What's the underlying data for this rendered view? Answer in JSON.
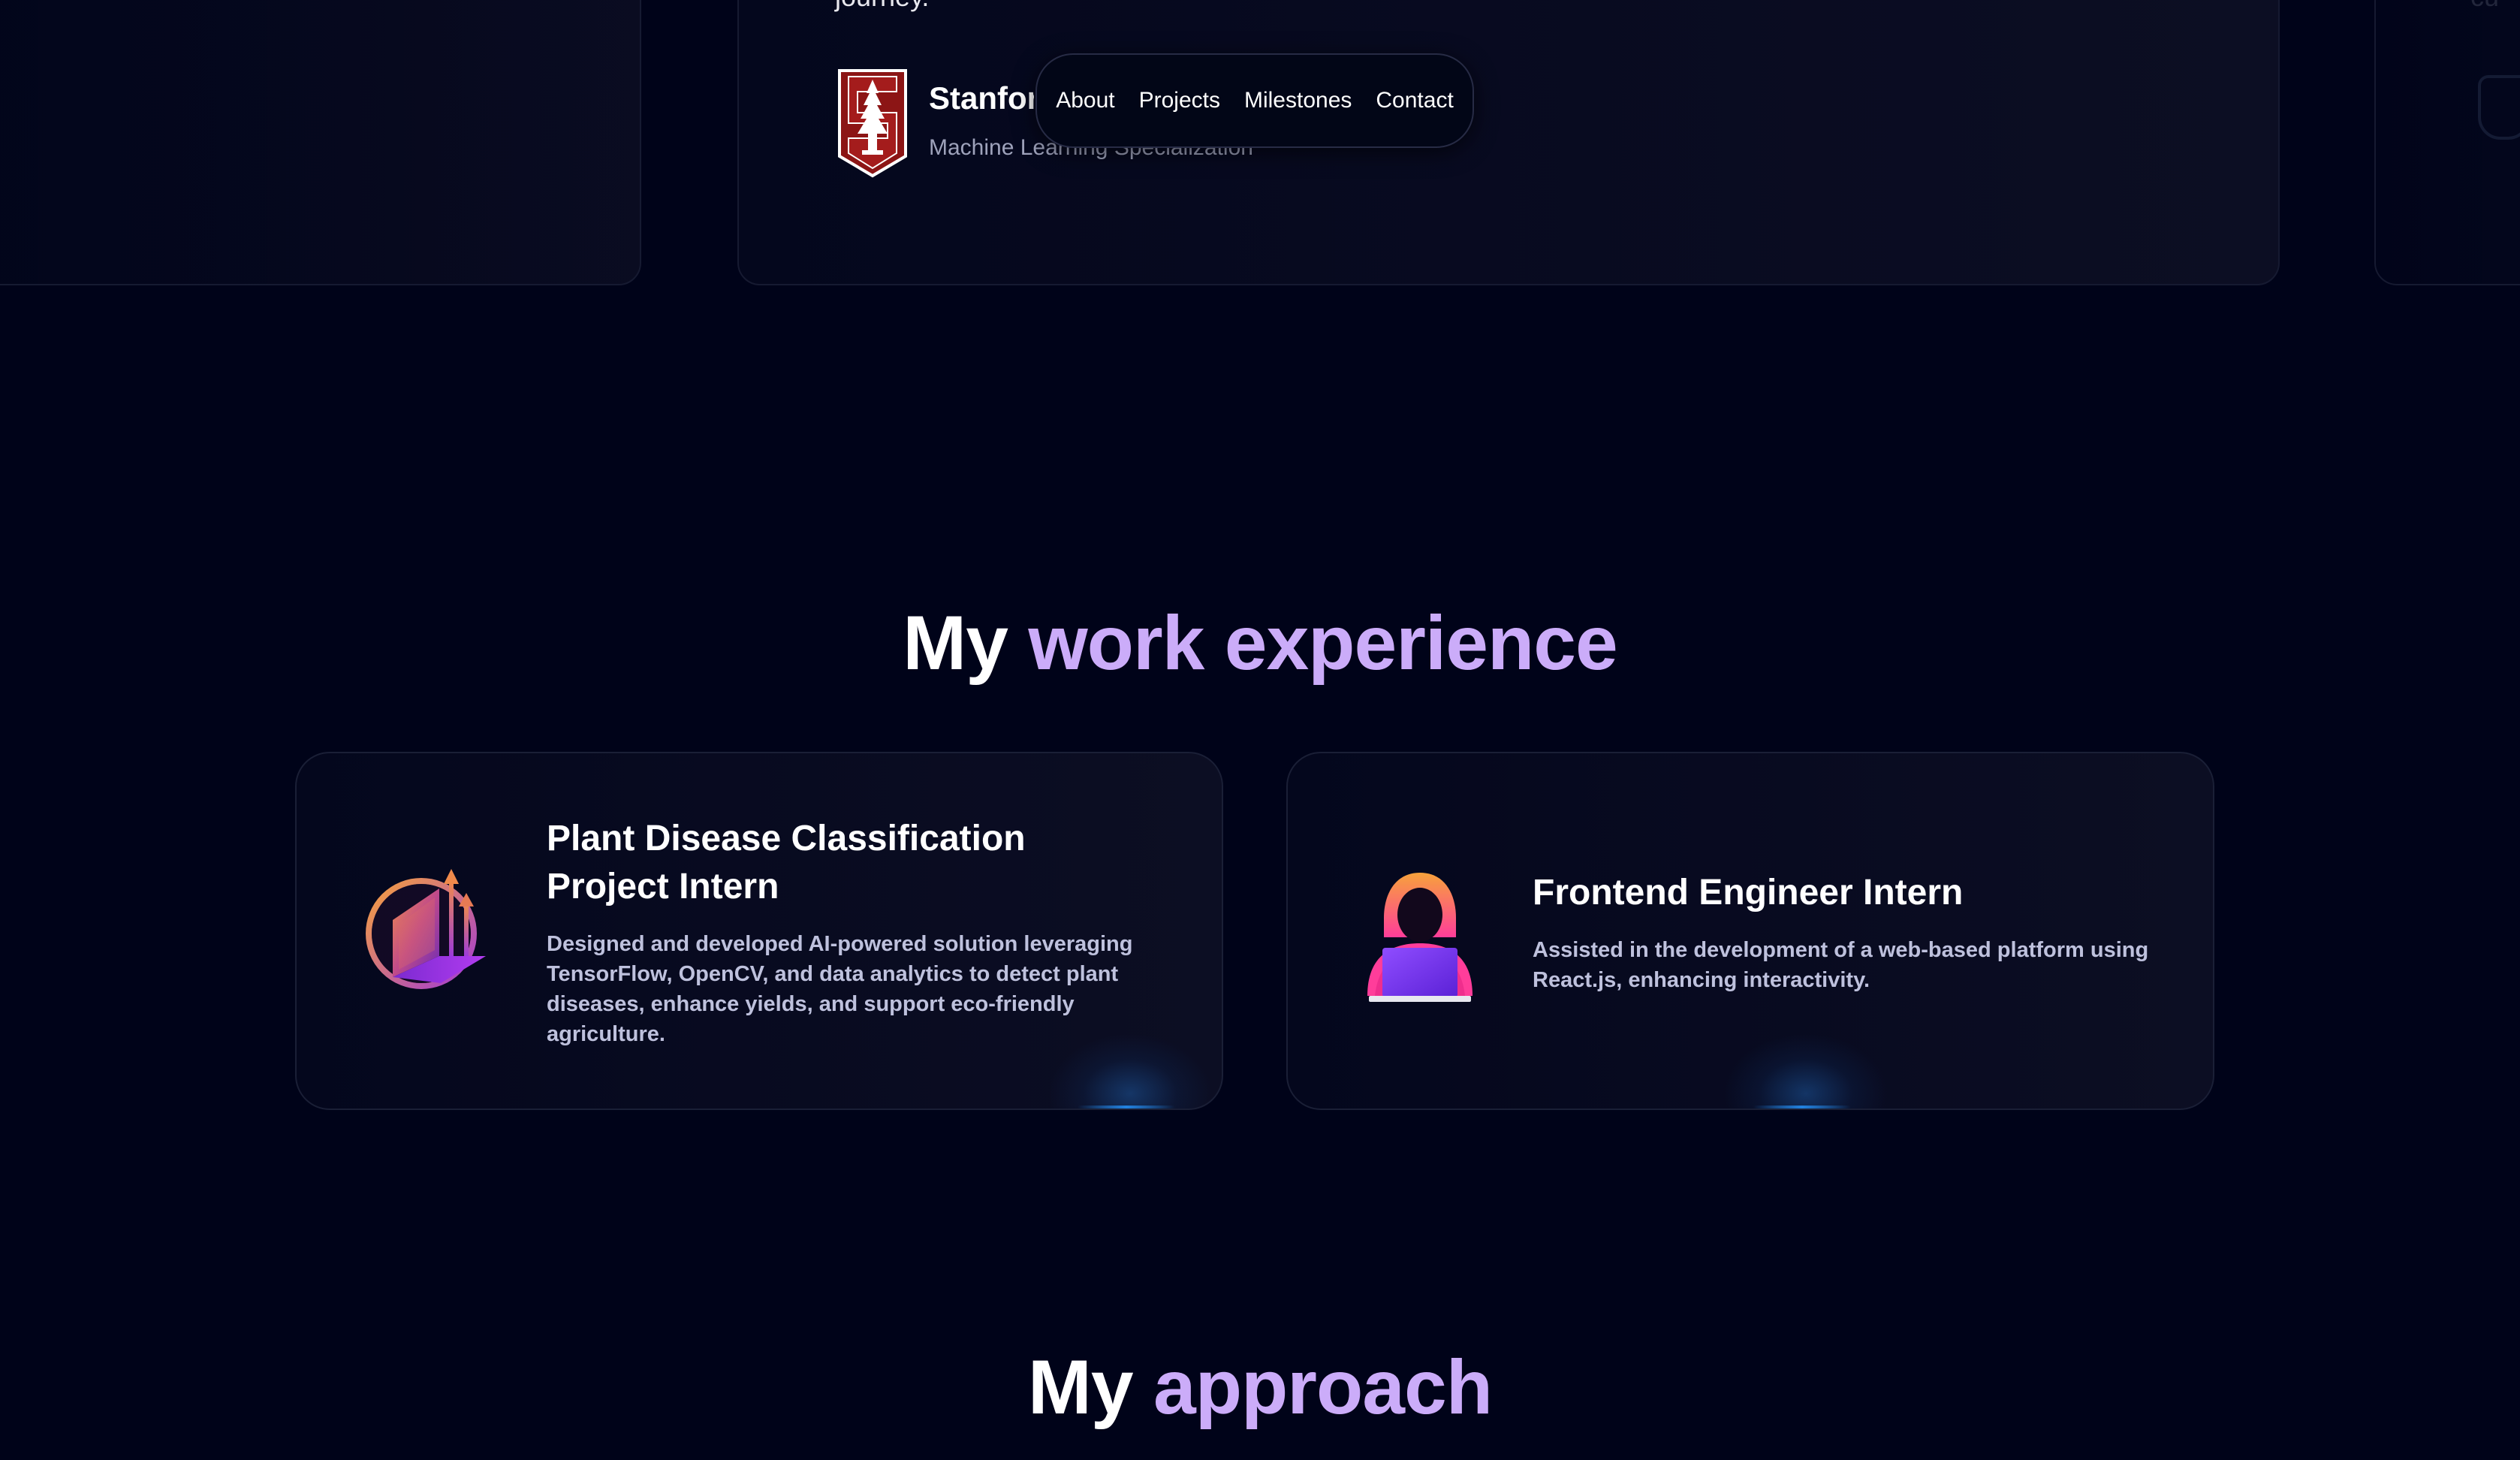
{
  "testimonial": {
    "quote_tail": "journey.",
    "name": "Stanford",
    "title": "Machine Learning Specialization",
    "next_card_fragment": "cu"
  },
  "nav": {
    "items": [
      {
        "label": "About"
      },
      {
        "label": "Projects"
      },
      {
        "label": "Milestones"
      },
      {
        "label": "Contact"
      }
    ]
  },
  "experience": {
    "heading_plain": "My",
    "heading_accent": "work experience",
    "cards": [
      {
        "title": "Plant Disease Classification Project Intern",
        "description": "Designed and developed AI-powered solution leveraging TensorFlow, OpenCV, and data analytics to detect plant diseases, enhance yields, and support eco-friendly agriculture.",
        "icon": "laptop-growth-icon"
      },
      {
        "title": "Frontend Engineer Intern",
        "description": "Assisted in the development of a web-based platform using React.js, enhancing interactivity.",
        "icon": "hooded-coder-icon"
      }
    ]
  },
  "approach": {
    "heading_plain": "My",
    "heading_accent": "approach"
  },
  "colors": {
    "background": "#000319",
    "accent": "#cbacf9",
    "card_border": "#1a1f36",
    "stanford_red": "#8c1515"
  }
}
